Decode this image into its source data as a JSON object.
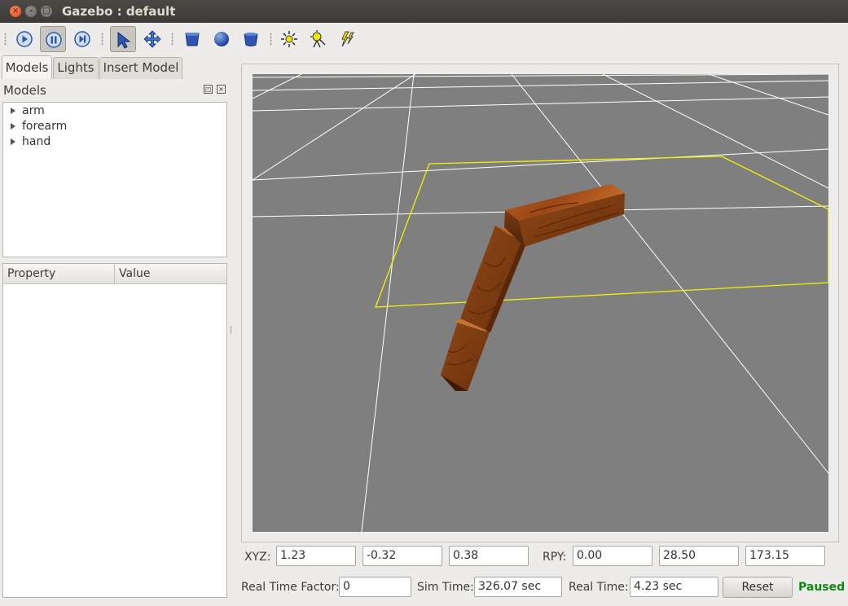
{
  "window": {
    "title": "Gazebo : default",
    "close_glyph": "×",
    "min_glyph": "–",
    "max_glyph": "□"
  },
  "toolbar": {
    "buttons": [
      {
        "name": "play-icon",
        "active": false
      },
      {
        "name": "pause-icon",
        "active": true
      },
      {
        "name": "step-icon",
        "active": false
      },
      {
        "name": "select-arrow-icon",
        "active": true
      },
      {
        "name": "translate-icon",
        "active": false
      },
      {
        "name": "box-icon",
        "active": false
      },
      {
        "name": "sphere-icon",
        "active": false
      },
      {
        "name": "cylinder-icon",
        "active": false
      },
      {
        "name": "point-light-icon",
        "active": false
      },
      {
        "name": "spot-light-icon",
        "active": false
      },
      {
        "name": "directional-light-icon",
        "active": false
      }
    ]
  },
  "tabs": [
    {
      "label": "Models",
      "selected": true
    },
    {
      "label": "Lights",
      "selected": false
    },
    {
      "label": "Insert Model",
      "selected": false
    }
  ],
  "models_panel": {
    "label": "Models",
    "float_glyph": "◰",
    "close_glyph": "×",
    "items": [
      "arm",
      "forearm",
      "hand"
    ]
  },
  "properties": {
    "col_property": "Property",
    "col_value": "Value"
  },
  "pose": {
    "xyz_label": "XYZ:",
    "x": "1.23",
    "y": "-0.32",
    "z": "0.38",
    "rpy_label": "RPY:",
    "roll": "0.00",
    "pitch": "28.50",
    "yaw": "173.15"
  },
  "status": {
    "rtf_label": "Real Time Factor:",
    "rtf": "0",
    "sim_label": "Sim Time:",
    "sim_time": "326.07 sec",
    "real_label": "Real Time:",
    "real_time": "4.23 sec",
    "reset_label": "Reset",
    "state": "Paused"
  },
  "colors": {
    "viewport_bg": "#7f7f7f",
    "grid": "#ffffff",
    "selection": "#f2f200",
    "wood": "#8b4513",
    "paused": "#108a10",
    "icon_blue": "#2f55b3"
  }
}
